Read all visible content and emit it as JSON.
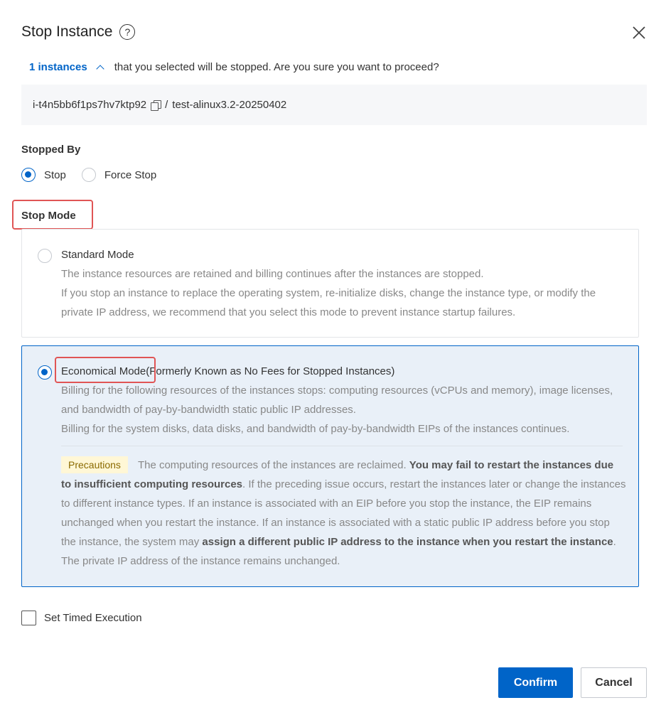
{
  "dialog": {
    "title": "Stop Instance",
    "help_icon_glyph": "?",
    "summary": {
      "count_link": "1 instances",
      "text": "that you selected will be stopped. Are you sure you want to proceed?"
    },
    "instance": {
      "id": "i-t4n5bb6f1ps7hv7ktp92",
      "separator": "/",
      "name": "test-alinux3.2-20250402"
    }
  },
  "stopped_by": {
    "label": "Stopped By",
    "options": [
      {
        "label": "Stop",
        "checked": true
      },
      {
        "label": "Force Stop",
        "checked": false
      }
    ]
  },
  "stop_mode": {
    "label": "Stop Mode",
    "standard": {
      "title": "Standard Mode",
      "checked": false,
      "desc_line1": "The instance resources are retained and billing continues after the instances are stopped.",
      "desc_line2": "If you stop an instance to replace the operating system, re-initialize disks, change the instance type, or modify the private IP address, we recommend that you select this mode to prevent instance startup failures."
    },
    "economical": {
      "title": "Economical Mode",
      "subtitle": "(Formerly Known as No Fees for Stopped Instances)",
      "checked": true,
      "desc_line1": "Billing for the following resources of the instances stops: computing resources (vCPUs and memory), image licenses, and bandwidth of pay-by-bandwidth static public IP addresses.",
      "desc_line2": "Billing for the system disks, data disks, and bandwidth of pay-by-bandwidth EIPs of the instances continues.",
      "precautions_tag": "Precautions",
      "prec_1": "The computing resources of the instances are reclaimed. ",
      "prec_bold_1": "You may fail to restart the instances due to insufficient computing resources",
      "prec_2": ". If the preceding issue occurs, restart the instances later or change the instances to different instance types. If an instance is associated with an EIP before you stop the instance, the EIP remains unchanged when you restart the instance. If an instance is associated with a static public IP address before you stop the instance, the system may ",
      "prec_bold_2": "assign a different public IP address to the instance when you restart the instance",
      "prec_3": ". The private IP address of the instance remains unchanged."
    }
  },
  "timed_execution": {
    "label": "Set Timed Execution",
    "checked": false
  },
  "buttons": {
    "confirm": "Confirm",
    "cancel": "Cancel"
  },
  "colors": {
    "primary": "#0064c8",
    "highlight": "#e05555",
    "selected_bg": "#e9f0f8",
    "precaution_bg": "#fff7d6"
  }
}
